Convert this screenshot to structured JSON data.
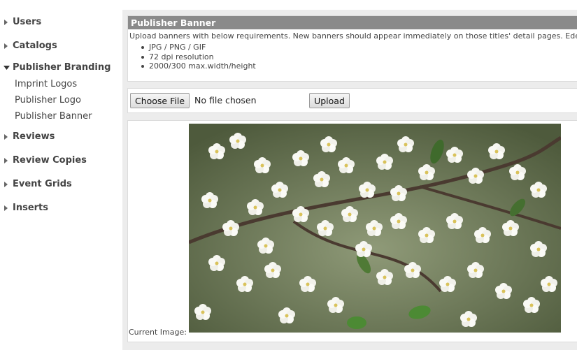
{
  "sidebar": {
    "items": [
      {
        "label": "Users",
        "expanded": false
      },
      {
        "label": "Catalogs",
        "expanded": false
      },
      {
        "label": "Publisher Branding",
        "expanded": true,
        "children": [
          "Imprint Logos",
          "Publisher Logo",
          "Publisher Banner"
        ]
      },
      {
        "label": "Reviews",
        "expanded": false
      },
      {
        "label": "Review Copies",
        "expanded": false
      },
      {
        "label": "Event Grids",
        "expanded": false
      },
      {
        "label": "Inserts",
        "expanded": false
      }
    ]
  },
  "panel": {
    "title": "Publisher Banner",
    "description": "Upload banners with below requirements. New banners should appear immediately on those titles' detail pages. Edelweiss wi",
    "requirements": [
      "JPG / PNG / GIF",
      "72 dpi resolution",
      "2000/300 max.width/height"
    ]
  },
  "upload": {
    "choose_label": "Choose File",
    "file_status": "No file chosen",
    "upload_label": "Upload"
  },
  "current": {
    "label": "Current Image:",
    "image_icon": "blossom-photo"
  },
  "colors": {
    "title_bar": "#8a8a8a",
    "panel_bg": "#ececec"
  }
}
